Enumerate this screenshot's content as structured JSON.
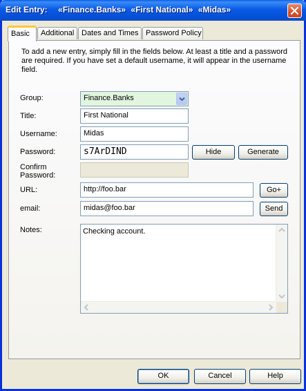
{
  "window": {
    "title_prefix": "Edit Entry:",
    "title_group": "«Finance.Banks»",
    "title_entry": "«First National»",
    "title_user": "«Midas»"
  },
  "tabs": [
    {
      "label": "Basic",
      "active": true
    },
    {
      "label": "Additional",
      "active": false
    },
    {
      "label": "Dates and Times",
      "active": false
    },
    {
      "label": "Password Policy",
      "active": false
    }
  ],
  "intro": "To add a new entry, simply fill in the fields below. At least a title and a password are required. If you have set a default username, it will appear in the username field.",
  "form": {
    "group_label": "Group:",
    "group_value": "Finance.Banks",
    "title_label": "Title:",
    "title_value": "First National",
    "username_label": "Username:",
    "username_value": "Midas",
    "password_label": "Password:",
    "password_value": "s7ArDIND",
    "confirm_label_1": "Confirm",
    "confirm_label_2": "Password:",
    "confirm_value": "",
    "url_label": "URL:",
    "url_value": "http://foo.bar",
    "email_label": "email:",
    "email_value": "midas@foo.bar",
    "notes_label": "Notes:",
    "notes_value": "Checking account."
  },
  "buttons": {
    "hide": "Hide",
    "generate": "Generate",
    "go": "Go+",
    "send": "Send",
    "ok": "OK",
    "cancel": "Cancel",
    "help": "Help"
  },
  "colors": {
    "title_bar": "#0A5AE6",
    "active_tab_accent": "#FFC83C",
    "group_combo_bg": "#E2F6DF",
    "dialog_bg": "#ECE9D8"
  }
}
